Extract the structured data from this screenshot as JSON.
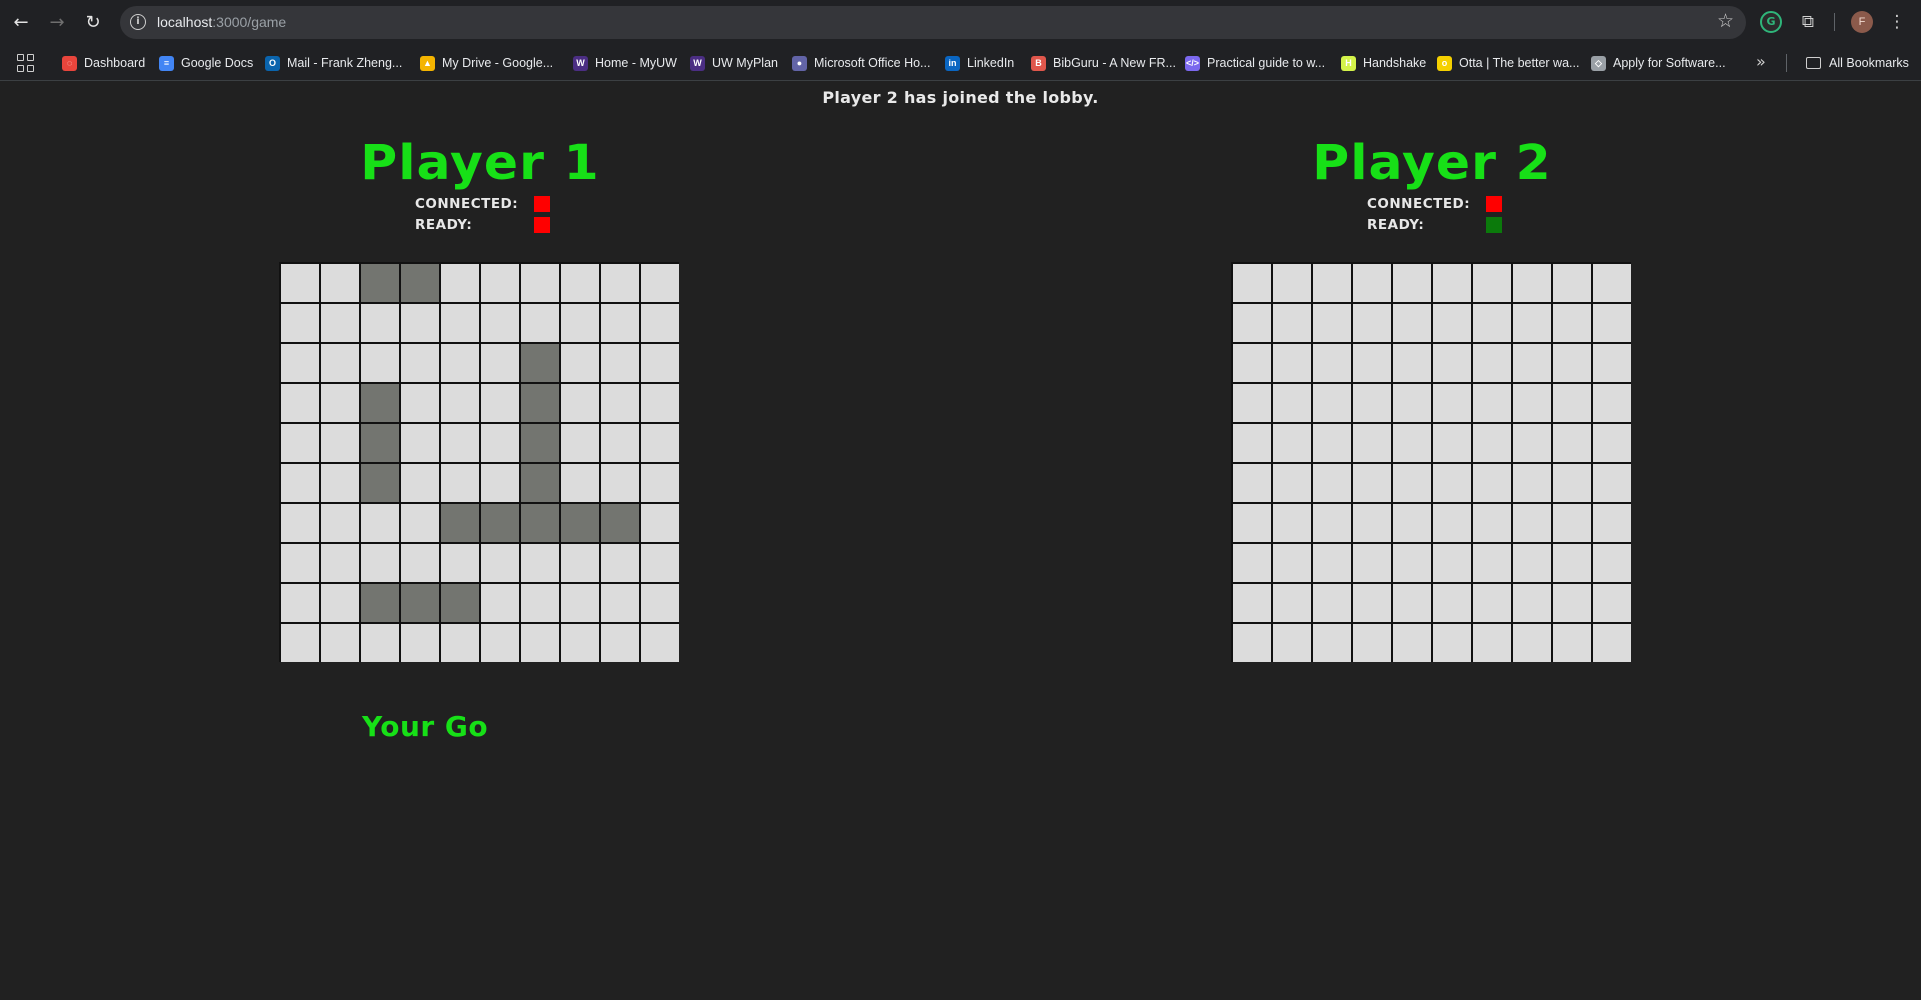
{
  "browser": {
    "url_host": "localhost",
    "url_path": ":3000/game",
    "bookmarks": [
      {
        "label": "Dashboard",
        "icon": "dashboard-icon",
        "color": "#e8453c"
      },
      {
        "label": "Google Docs",
        "icon": "docs-icon",
        "color": "#4285f4"
      },
      {
        "label": "Mail - Frank Zheng...",
        "icon": "outlook-icon",
        "color": "#0a64ad"
      },
      {
        "label": "My Drive - Google...",
        "icon": "drive-icon",
        "color": "#f4b400"
      },
      {
        "label": "Home - MyUW",
        "icon": "uw-icon",
        "color": "#4b2e83"
      },
      {
        "label": "UW MyPlan",
        "icon": "uw-icon",
        "color": "#4b2e83"
      },
      {
        "label": "Microsoft Office Ho...",
        "icon": "office-icon",
        "color": "#6264a7"
      },
      {
        "label": "LinkedIn",
        "icon": "linkedin-icon",
        "color": "#0a66c2"
      },
      {
        "label": "BibGuru - A New FR...",
        "icon": "bibguru-icon",
        "color": "#e0574c"
      },
      {
        "label": "Practical guide to w...",
        "icon": "code-icon",
        "color": "#7b68ee"
      },
      {
        "label": "Handshake",
        "icon": "handshake-icon",
        "color": "#d4f34a"
      },
      {
        "label": "Otta | The better wa...",
        "icon": "otta-icon",
        "color": "#f5d000"
      },
      {
        "label": "Apply for Software...",
        "icon": "apply-icon",
        "color": "#9aa0a6"
      }
    ],
    "all_bookmarks_label": "All Bookmarks",
    "profile_initial": "F"
  },
  "game": {
    "status_message": "Player 2 has joined the lobby.",
    "connected_label": "CONNECTED:",
    "ready_label": "READY:",
    "turn_message": "Your Go",
    "status_colors": {
      "red": "#ff0000",
      "green": "#0b7a0b"
    },
    "players": [
      {
        "name": "Player 1",
        "connected": false,
        "ready": false,
        "board": [
          "0011000000",
          "0000000000",
          "0000001000",
          "0010001000",
          "0010001000",
          "0010001000",
          "0000111110",
          "0000000000",
          "0011100000",
          "0000000000"
        ]
      },
      {
        "name": "Player 2",
        "connected": false,
        "ready": true,
        "board": [
          "0000000000",
          "0000000000",
          "0000000000",
          "0000000000",
          "0000000000",
          "0000000000",
          "0000000000",
          "0000000000",
          "0000000000",
          "0000000000"
        ]
      }
    ]
  }
}
